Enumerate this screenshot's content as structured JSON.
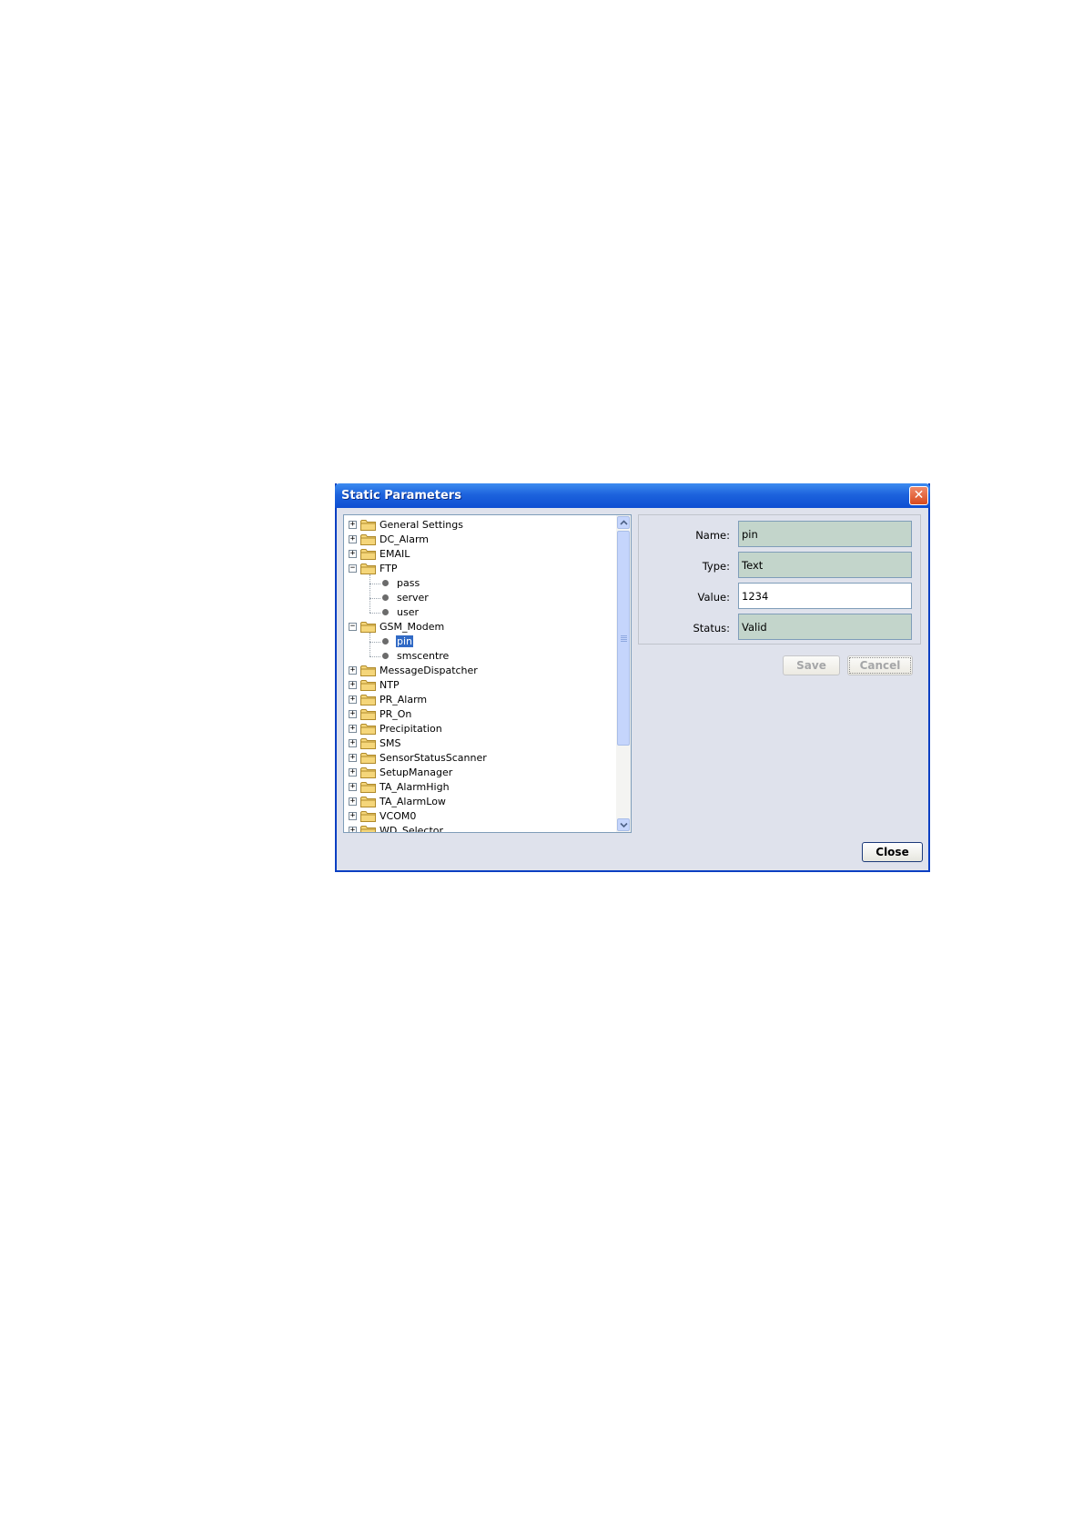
{
  "dialog": {
    "title": "Static Parameters",
    "close_glyph": "✕"
  },
  "tree": {
    "folders": [
      {
        "label": "General Settings",
        "expanded": false
      },
      {
        "label": "DC_Alarm",
        "expanded": false
      },
      {
        "label": "EMAIL",
        "expanded": false
      },
      {
        "label": "FTP",
        "expanded": true,
        "children": [
          "pass",
          "server",
          "user"
        ]
      },
      {
        "label": "GSM_Modem",
        "expanded": true,
        "children": [
          "pin",
          "smscentre"
        ]
      },
      {
        "label": "MessageDispatcher",
        "expanded": false
      },
      {
        "label": "NTP",
        "expanded": false
      },
      {
        "label": "PR_Alarm",
        "expanded": false
      },
      {
        "label": "PR_On",
        "expanded": false
      },
      {
        "label": "Precipitation",
        "expanded": false
      },
      {
        "label": "SMS",
        "expanded": false
      },
      {
        "label": "SensorStatusScanner",
        "expanded": false
      },
      {
        "label": "SetupManager",
        "expanded": false
      },
      {
        "label": "TA_AlarmHigh",
        "expanded": false
      },
      {
        "label": "TA_AlarmLow",
        "expanded": false
      },
      {
        "label": "VCOM0",
        "expanded": false
      },
      {
        "label": "WD_Selector",
        "expanded": false
      }
    ],
    "selected": "pin",
    "expand_glyph": "+",
    "collapse_glyph": "−"
  },
  "properties": {
    "name_label": "Name:",
    "name_value": "pin",
    "type_label": "Type:",
    "type_value": "Text",
    "value_label": "Value:",
    "value_value": "1234",
    "status_label": "Status:",
    "status_value": "Valid"
  },
  "buttons": {
    "save": "Save",
    "cancel": "Cancel",
    "close": "Close"
  },
  "colors": {
    "titlebar": "#1d63dd",
    "selection": "#316ac5",
    "readonly_field": "#c3d5cb",
    "folder_fill": "#f5d67a",
    "folder_stroke": "#b08a2a"
  },
  "icons": {
    "folder": "folder-icon",
    "leaf": "leaf-dot-icon",
    "close": "close-icon",
    "scroll_up": "scroll-up-arrow-icon",
    "scroll_down": "scroll-down-arrow-icon"
  }
}
